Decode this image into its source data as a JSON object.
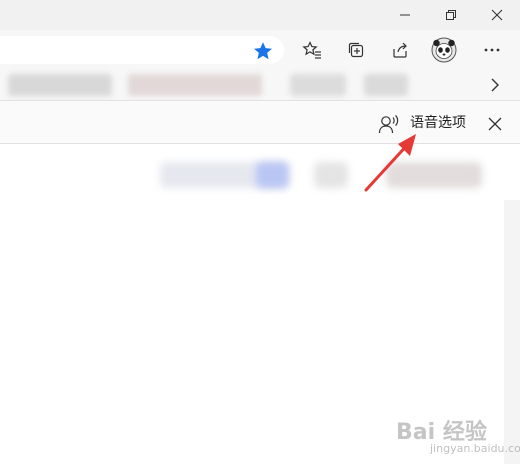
{
  "window_controls": {
    "minimize": "minimize-icon",
    "restore": "restore-icon",
    "close": "close-icon"
  },
  "toolbar": {
    "favorite_star_color": "#1a73e8",
    "icons": [
      "favorites-list-icon",
      "collections-icon",
      "share-icon",
      "profile-avatar",
      "more-icon"
    ]
  },
  "read_aloud_bar": {
    "voice_options_label": "语音选项",
    "voice_icon": "voice-options-icon",
    "close_icon": "close-icon"
  },
  "annotation": {
    "arrow_color": "#e53935"
  },
  "watermark": {
    "text": "Bai 经验",
    "sub": "jingyan.baidu.com"
  }
}
